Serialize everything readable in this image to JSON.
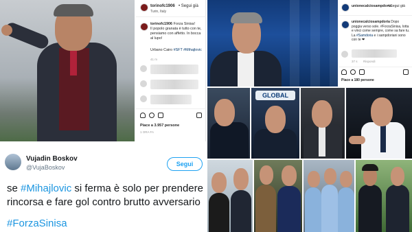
{
  "ig_post_torino": {
    "username": "torinofc1906",
    "follow_label": "• Segui già",
    "location": "Turin, Italy",
    "caption_user": "torinofc1906",
    "caption_lead": "Forza Sinisa!",
    "caption_body": "Il popolo granata è tutto con te, pensiamo con affetto. In bocca al lupo!",
    "signature": "Urbano Cairo",
    "hashtags": "#SFT #Mihajlovic",
    "time_ago": "41 m",
    "likes": "Piace a 3.957 persone",
    "date": "1 ORA FA"
  },
  "tweet": {
    "display_name": "Vujadin Boskov",
    "handle": "@VujaBoskov",
    "follow_label": "Segui",
    "text_prefix": "se ",
    "text_hashtag": "#Mihajlovic",
    "text_line1_rest": " si ferma è solo per prendere",
    "text_line2": "rincorsa e fare gol contro brutto avversario",
    "tag_line": "#ForzaSinisa"
  },
  "ig_post_samp": {
    "username": "unionecalciosampdoria",
    "follow_label": "• Segui già",
    "caption_user": "unionecalciosampdoria",
    "caption_text": "Dopo poggia verso sole. #ForzaSinisa, lotta e vinci come sempre, come sa fare tu. La",
    "caption_hashtag": "#Samdoria",
    "caption_tail": "e i sampdoriani sono con te ❤",
    "time_ago": "37 s",
    "reply_label": "Rispondi",
    "likes": "Piace a 180 persone"
  },
  "collage_banner": "GLOBAL",
  "icons": [
    "heart-icon",
    "comment-icon",
    "share-icon",
    "bookmark-icon",
    "more-icon"
  ],
  "colors": {
    "twitter_blue": "#1da1f2",
    "hashtag_blue": "#1b95e0",
    "torino_red": "#7a1b1b",
    "samp_blue": "#123a78"
  }
}
